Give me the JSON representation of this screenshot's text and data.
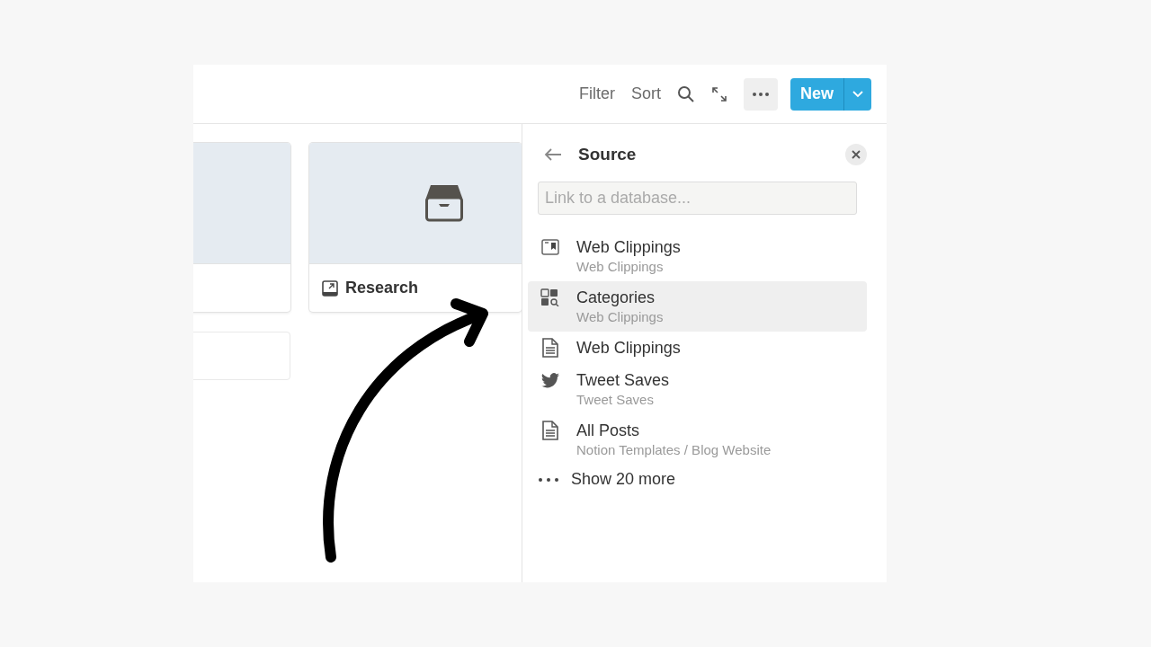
{
  "toolbar": {
    "filter": "Filter",
    "sort": "Sort",
    "new_button": "New"
  },
  "gallery": {
    "cards": [
      {
        "title": "Research"
      }
    ]
  },
  "source_panel": {
    "title": "Source",
    "search": {
      "placeholder": "Link to a database..."
    },
    "items": [
      {
        "kind": "webclip",
        "title": "Web Clippings",
        "subtitle": "Web Clippings",
        "selected": false
      },
      {
        "kind": "gallery",
        "title": "Categories",
        "subtitle": "Web Clippings",
        "selected": true
      },
      {
        "kind": "page",
        "title": "Web Clippings",
        "selected": false
      },
      {
        "kind": "twitter",
        "title": "Tweet Saves",
        "subtitle": "Tweet Saves",
        "selected": false
      },
      {
        "kind": "page",
        "title": "All Posts",
        "subtitle": "Notion Templates / Blog Website",
        "selected": false
      }
    ],
    "show_more": "Show 20 more"
  }
}
